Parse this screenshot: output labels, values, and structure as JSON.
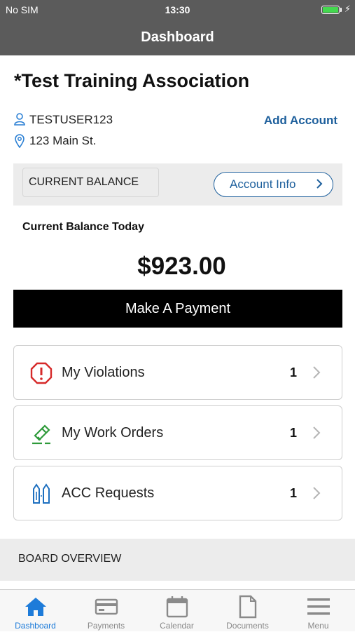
{
  "status_bar": {
    "carrier": "No SIM",
    "time": "13:30"
  },
  "nav": {
    "title": "Dashboard"
  },
  "association": {
    "name": "*Test Training Association",
    "username": "TESTUSER123",
    "address": "123 Main St.",
    "add_account_label": "Add Account"
  },
  "balance": {
    "tab_label": "CURRENT BALANCE",
    "account_info_label": "Account Info",
    "label": "Current Balance Today",
    "amount": "$923.00",
    "pay_button_label": "Make A Payment"
  },
  "cards": [
    {
      "label": "My Violations",
      "count": "1",
      "icon": "violation-octagon-icon",
      "color": "#d62a2a"
    },
    {
      "label": "My Work Orders",
      "count": "1",
      "icon": "work-order-icon",
      "color": "#2e9a3a"
    },
    {
      "label": "ACC Requests",
      "count": "1",
      "icon": "acc-request-icon",
      "color": "#1d6fbf"
    }
  ],
  "board_overview": {
    "label": "BOARD OVERVIEW"
  },
  "tabs": [
    {
      "label": "Dashboard",
      "icon": "home-icon",
      "active": true
    },
    {
      "label": "Payments",
      "icon": "credit-card-icon",
      "active": false
    },
    {
      "label": "Calendar",
      "icon": "calendar-icon",
      "active": false
    },
    {
      "label": "Documents",
      "icon": "document-icon",
      "active": false
    },
    {
      "label": "Menu",
      "icon": "hamburger-menu-icon",
      "active": false
    }
  ],
  "colors": {
    "accent": "#1d5f9c",
    "tab_active": "#1d7bd9",
    "header": "#5b5b5b"
  }
}
